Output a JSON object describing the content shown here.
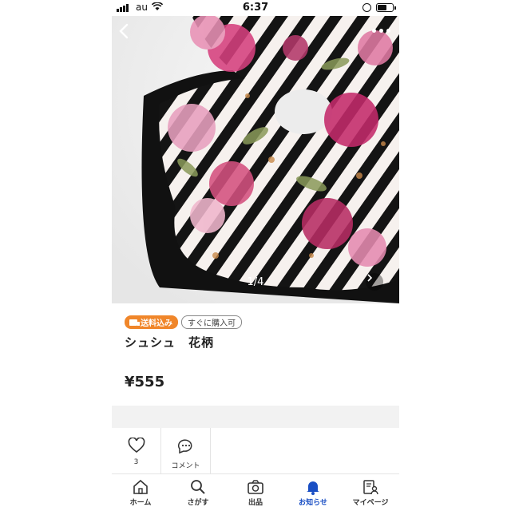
{
  "status_bar": {
    "carrier": "au",
    "time": "6:37"
  },
  "image_viewer": {
    "counter": "1/4",
    "back_icon": "chevron-left-icon",
    "more_icon": "more-dots-icon",
    "next_icon": "chevron-right-icon"
  },
  "product": {
    "badges": {
      "shipping": "送料込み",
      "buy_now": "すぐに購入可"
    },
    "title": "シュシュ　花柄",
    "price": "¥555"
  },
  "actions": [
    {
      "icon": "heart-icon",
      "label": "3"
    },
    {
      "icon": "comment-icon",
      "label": "コメント"
    }
  ],
  "tab_bar": [
    {
      "icon": "home-icon",
      "label": "ホーム"
    },
    {
      "icon": "search-icon",
      "label": "さがす"
    },
    {
      "icon": "camera-icon",
      "label": "出品"
    },
    {
      "icon": "bell-icon",
      "label": "お知らせ",
      "active": true
    },
    {
      "icon": "mypage-icon",
      "label": "マイページ"
    }
  ],
  "colors": {
    "accent_orange": "#f0862a",
    "active_blue": "#1a4fc4"
  }
}
